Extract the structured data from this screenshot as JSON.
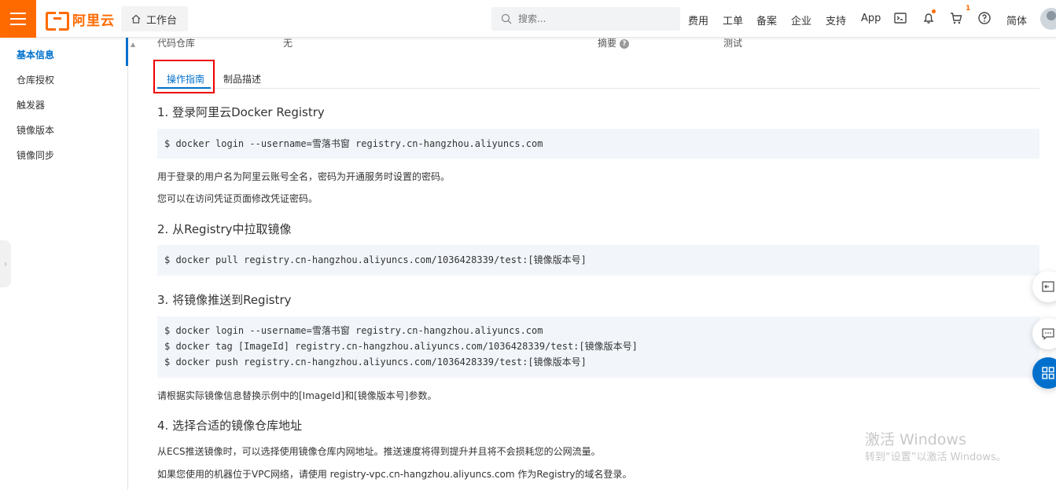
{
  "topbar": {
    "brand": "阿里云",
    "workbench": "工作台",
    "search_placeholder": "搜索...",
    "nav": [
      "费用",
      "工单",
      "备案",
      "企业",
      "支持",
      "App"
    ],
    "cart_badge": "1",
    "lang": "简体",
    "accent": "#ff6a00"
  },
  "sidebar": {
    "items": [
      "基本信息",
      "仓库授权",
      "触发器",
      "镜像版本",
      "镜像同步"
    ],
    "active_index": 0
  },
  "info": {
    "repo_label": "代码仓库",
    "repo_value": "无",
    "summary_label": "摘要",
    "summary_value": "测试"
  },
  "tabs": [
    "操作指南",
    "制品描述"
  ],
  "guide": {
    "s1_title": "1. 登录阿里云Docker Registry",
    "s1_code": [
      "$ docker login --username=雪落书窗 registry.cn-hangzhou.aliyuncs.com"
    ],
    "s1_p1": "用于登录的用户名为阿里云账号全名，密码为开通服务时设置的密码。",
    "s1_p2": "您可以在访问凭证页面修改凭证密码。",
    "s2_title": "2. 从Registry中拉取镜像",
    "s2_code": [
      "$ docker pull registry.cn-hangzhou.aliyuncs.com/1036428339/test:[镜像版本号]"
    ],
    "s3_title": "3. 将镜像推送到Registry",
    "s3_code": [
      "$ docker login --username=雪落书窗 registry.cn-hangzhou.aliyuncs.com",
      "$ docker tag [ImageId] registry.cn-hangzhou.aliyuncs.com/1036428339/test:[镜像版本号]",
      "$ docker push registry.cn-hangzhou.aliyuncs.com/1036428339/test:[镜像版本号]"
    ],
    "s3_p1": "请根据实际镜像信息替换示例中的[ImageId]和[镜像版本号]参数。",
    "s4_title": "4. 选择合适的镜像仓库地址",
    "s4_p1": "从ECS推送镜像时，可以选择使用镜像仓库内网地址。推送速度将得到提升并且将不会损耗您的公网流量。",
    "s4_p2": "如果您使用的机器位于VPC网络，请使用 registry-vpc.cn-hangzhou.aliyuncs.com 作为Registry的域名登录。"
  },
  "watermark": {
    "line1": "激活 Windows",
    "line2": "转到“设置”以激活 Windows。"
  }
}
